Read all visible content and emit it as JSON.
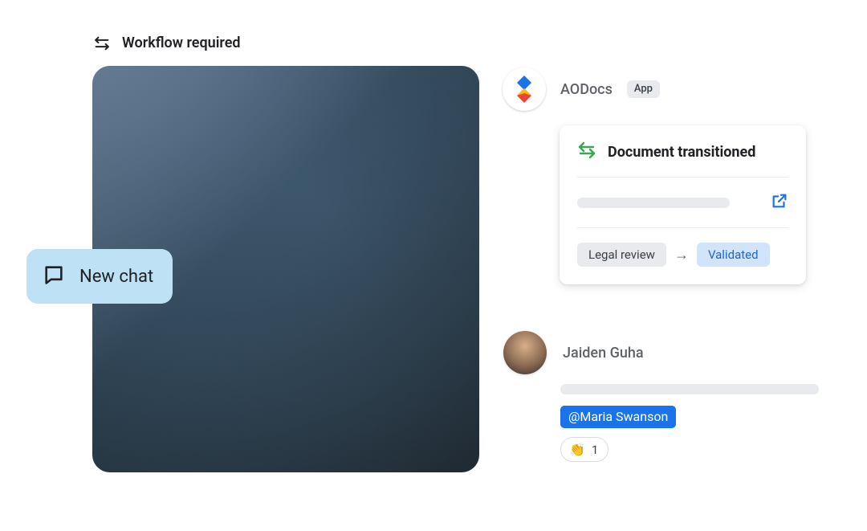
{
  "workflow": {
    "label": "Workflow required"
  },
  "newchat": {
    "label": "New chat"
  },
  "aodocs": {
    "name": "AODocs",
    "badge": "App"
  },
  "doc_card": {
    "title": "Document transitioned",
    "from_tag": "Legal review",
    "to_tag": "Validated"
  },
  "person": {
    "name": "Jaiden Guha"
  },
  "mention": {
    "text": "@Maria Swanson"
  },
  "reaction": {
    "emoji": "👏",
    "count": "1"
  }
}
